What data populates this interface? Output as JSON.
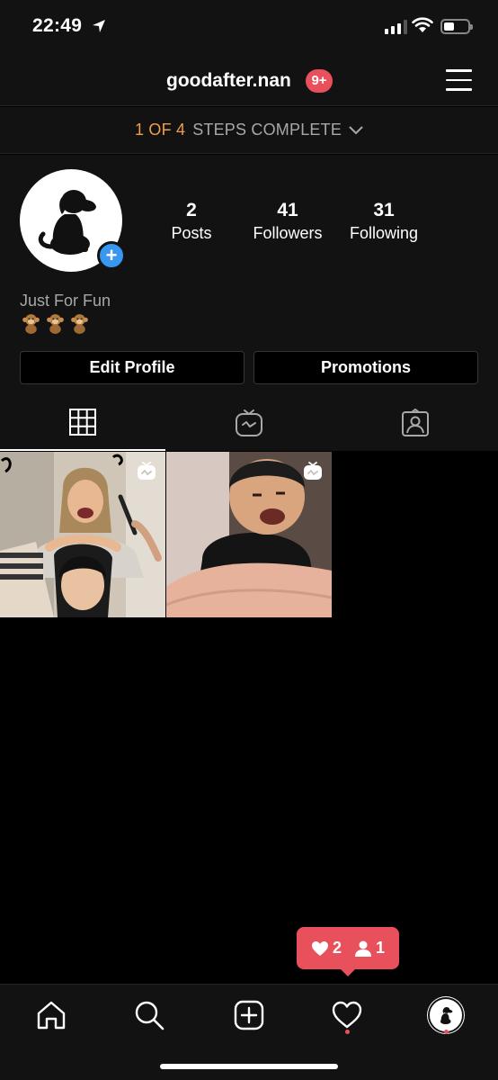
{
  "status_bar": {
    "time": "22:49",
    "signal_bars": 3,
    "signal_bars_total": 4,
    "battery_level": 0.45
  },
  "header": {
    "username": "goodafter.nan",
    "notification_count": "9+",
    "menu_icon": "hamburger-menu-icon"
  },
  "steps": {
    "progress": "1 OF 4",
    "label": "STEPS COMPLETE"
  },
  "profile": {
    "stats": {
      "posts_count": "2",
      "posts_label": "Posts",
      "followers_count": "41",
      "followers_label": "Followers",
      "following_count": "31",
      "following_label": "Following"
    },
    "bio_name": "Just For Fun",
    "bio_emoji": [
      "monkey",
      "monkey",
      "monkey"
    ],
    "buttons": {
      "edit_profile": "Edit Profile",
      "promotions": "Promotions"
    },
    "tabs": [
      "grid-icon",
      "igtv-icon",
      "tagged-icon"
    ]
  },
  "grid": {
    "posts": [
      {
        "type": "igtv-video",
        "description_icon": "igtv-small-icon"
      },
      {
        "type": "igtv-video",
        "description_icon": "igtv-small-icon"
      }
    ]
  },
  "activity_popup": {
    "likes": "2",
    "follows": "1"
  },
  "bottom_nav": {
    "items": [
      "home-icon",
      "search-icon",
      "create-post-icon",
      "activity-heart-icon",
      "profile-avatar-icon"
    ]
  },
  "colors": {
    "accent_orange": "#f19e4a",
    "badge_red": "#e8505c",
    "add_blue": "#3897f0",
    "surface": "#121212"
  }
}
